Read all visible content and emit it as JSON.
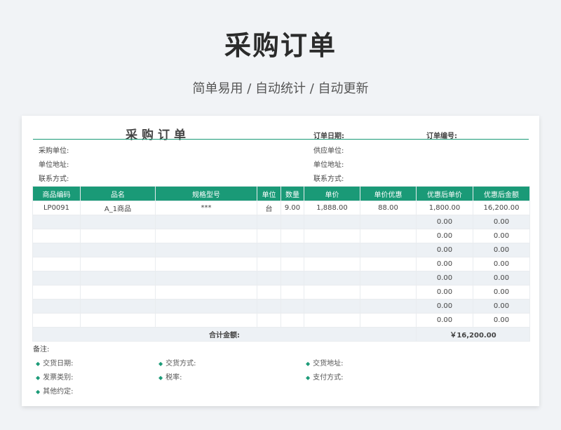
{
  "header": {
    "title": "采购订单",
    "subtitle": "简单易用  /  自动统计  /  自动更新"
  },
  "sheet": {
    "title": "采购订单",
    "order_date_label": "订单日期:",
    "order_no_label": "订单编号:",
    "left_fields": [
      "采购单位:",
      "单位地址:",
      "联系方式:"
    ],
    "right_fields": [
      "供应单位:",
      "单位地址:",
      "联系方式:"
    ]
  },
  "table": {
    "columns": [
      "商品编码",
      "品名",
      "规格型号",
      "单位",
      "数量",
      "单价",
      "单价优惠",
      "优惠后单价",
      "优惠后金额"
    ],
    "rows": [
      [
        "LP0091",
        "A_1商品",
        "***",
        "台",
        "9.00",
        "1,888.00",
        "88.00",
        "1,800.00",
        "16,200.00"
      ],
      [
        "",
        "",
        "",
        "",
        "",
        "",
        "",
        "0.00",
        "0.00"
      ],
      [
        "",
        "",
        "",
        "",
        "",
        "",
        "",
        "0.00",
        "0.00"
      ],
      [
        "",
        "",
        "",
        "",
        "",
        "",
        "",
        "0.00",
        "0.00"
      ],
      [
        "",
        "",
        "",
        "",
        "",
        "",
        "",
        "0.00",
        "0.00"
      ],
      [
        "",
        "",
        "",
        "",
        "",
        "",
        "",
        "0.00",
        "0.00"
      ],
      [
        "",
        "",
        "",
        "",
        "",
        "",
        "",
        "0.00",
        "0.00"
      ],
      [
        "",
        "",
        "",
        "",
        "",
        "",
        "",
        "0.00",
        "0.00"
      ],
      [
        "",
        "",
        "",
        "",
        "",
        "",
        "",
        "0.00",
        "0.00"
      ]
    ],
    "total_label": "合计金额:",
    "total_value": "￥16,200.00"
  },
  "notes": {
    "label": "备注:",
    "items": [
      "交货日期:",
      "交货方式:",
      "交货地址:",
      "发票类别:",
      "税率:",
      "支付方式:",
      "其他约定:"
    ]
  }
}
